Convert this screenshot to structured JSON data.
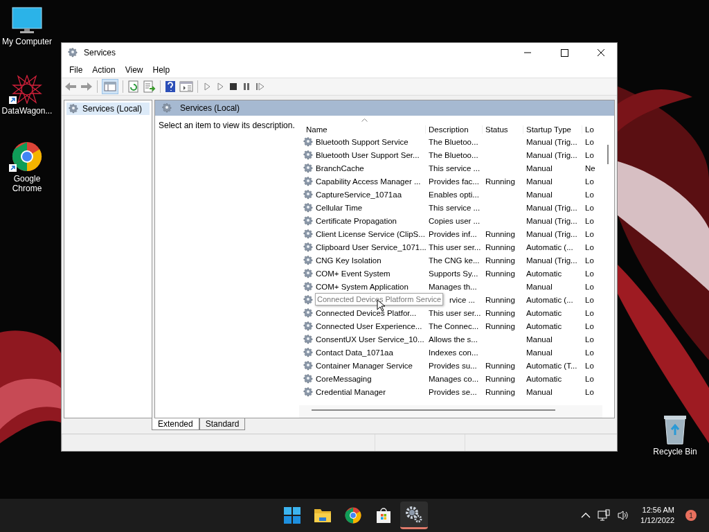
{
  "desktop": {
    "icons": [
      {
        "label": "My Computer",
        "kind": "computer",
        "shortcut": false
      },
      {
        "label": "DataWagon...",
        "kind": "star",
        "shortcut": true
      },
      {
        "label": "Google Chrome",
        "kind": "chrome",
        "shortcut": true
      },
      {
        "label": "Recycle Bin",
        "kind": "recycle",
        "shortcut": false
      }
    ]
  },
  "window": {
    "title": "Services",
    "menu": [
      "File",
      "Action",
      "View",
      "Help"
    ],
    "tree": [
      {
        "label": "Services (Local)",
        "selected": true
      }
    ],
    "header": "Services (Local)",
    "hint": "Select an item to view its description.",
    "columns": [
      "Name",
      "Description",
      "Status",
      "Startup Type",
      "Lo"
    ],
    "rows": [
      {
        "name": "Bluetooth Support Service",
        "description": "The Bluetoo...",
        "startup_type": "Manual (Trig...",
        "column_5": "Lo"
      },
      {
        "name": "Bluetooth User Support Ser...",
        "description": "The Bluetoo...",
        "startup_type": "Manual (Trig...",
        "column_5": "Lo"
      },
      {
        "name": "BranchCache",
        "description": "This service ...",
        "startup_type": "Manual",
        "column_5": "Ne"
      },
      {
        "name": "Capability Access Manager ...",
        "description": "Provides fac...",
        "status": "Running",
        "startup_type": "Manual",
        "column_5": "Lo"
      },
      {
        "name": "CaptureService_1071aa",
        "description": "Enables opti...",
        "startup_type": "Manual",
        "column_5": "Lo"
      },
      {
        "name": "Cellular Time",
        "description": "This service ...",
        "startup_type": "Manual (Trig...",
        "column_5": "Lo"
      },
      {
        "name": "Certificate Propagation",
        "description": "Copies user ...",
        "startup_type": "Manual (Trig...",
        "column_5": "Lo"
      },
      {
        "name": "Client License Service (ClipS...",
        "description": "Provides inf...",
        "status": "Running",
        "startup_type": "Manual (Trig...",
        "column_5": "Lo"
      },
      {
        "name": "Clipboard User Service_1071...",
        "description": "This user ser...",
        "status": "Running",
        "startup_type": "Automatic (...",
        "column_5": "Lo"
      },
      {
        "name": "CNG Key Isolation",
        "description": "The CNG ke...",
        "status": "Running",
        "startup_type": "Manual (Trig...",
        "column_5": "Lo"
      },
      {
        "name": "COM+ Event System",
        "description": "Supports Sy...",
        "status": "Running",
        "startup_type": "Automatic",
        "column_5": "Lo"
      },
      {
        "name": "COM+ System Application",
        "description": "Manages th...",
        "startup_type": "Manual",
        "column_5": "Lo"
      },
      {
        "description": "rvice ...",
        "status": "Running",
        "startup_type": "Automatic (...",
        "column_5": "Lo",
        "tooltip": "Connected Devices Platform Service"
      },
      {
        "name": "Connected Devices Platfor...",
        "description": "This user ser...",
        "status": "Running",
        "startup_type": "Automatic",
        "column_5": "Lo"
      },
      {
        "name": "Connected User Experience...",
        "description": "The Connec...",
        "status": "Running",
        "startup_type": "Automatic",
        "column_5": "Lo"
      },
      {
        "name": "ConsentUX User Service_10...",
        "description": "Allows the s...",
        "startup_type": "Manual",
        "column_5": "Lo"
      },
      {
        "name": "Contact Data_1071aa",
        "description": "Indexes con...",
        "startup_type": "Manual",
        "column_5": "Lo"
      },
      {
        "name": "Container Manager Service",
        "description": "Provides su...",
        "status": "Running",
        "startup_type": "Automatic (T...",
        "column_5": "Lo"
      },
      {
        "name": "CoreMessaging",
        "description": "Manages co...",
        "status": "Running",
        "startup_type": "Automatic",
        "column_5": "Lo"
      },
      {
        "name": "Credential Manager",
        "description": "Provides se...",
        "status": "Running",
        "startup_type": "Manual",
        "column_5": "Lo"
      }
    ],
    "tabs": [
      {
        "label": "Extended",
        "selected": true
      },
      {
        "label": "Standard",
        "selected": false
      }
    ]
  },
  "taskbar": {
    "apps": [
      {
        "kind": "start",
        "active": false
      },
      {
        "kind": "folder",
        "active": false
      },
      {
        "kind": "chrome",
        "active": false
      },
      {
        "kind": "store",
        "active": false
      },
      {
        "kind": "gear",
        "active": true
      }
    ],
    "time": "12:56 AM",
    "date": "1/12/2022",
    "notifications": "1"
  }
}
